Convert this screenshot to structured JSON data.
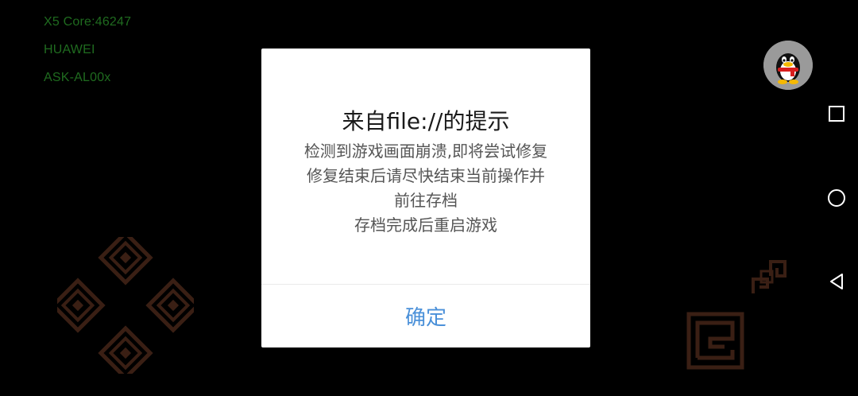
{
  "debug": {
    "core": "X5 Core:46247",
    "brand": "HUAWEI",
    "model": "ASK-AL00x"
  },
  "dialog": {
    "title": "来自file://的提示",
    "lines": [
      "检测到游戏画面崩溃,即将尝试修复",
      "修复结束后请尽快结束当前操作并",
      "前往存档",
      "存档完成后重启游戏"
    ],
    "confirm": "确定"
  },
  "colors": {
    "debug_text": "#1f6b1f",
    "accent": "#4a90d9",
    "control_tint": "#3a1f14"
  }
}
